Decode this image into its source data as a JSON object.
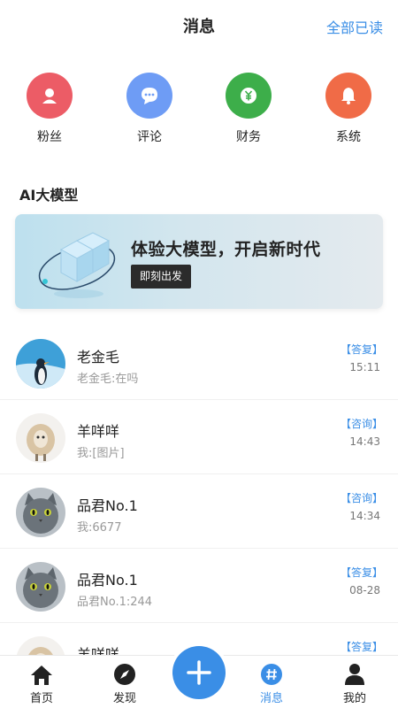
{
  "header": {
    "title": "消息",
    "mark_all_read": "全部已读"
  },
  "categories": [
    {
      "label": "粉丝",
      "icon": "person-icon",
      "color": "#ec5c66"
    },
    {
      "label": "评论",
      "icon": "chat-bubble-icon",
      "color": "#6e9cf5"
    },
    {
      "label": "财务",
      "icon": "yuan-icon",
      "color": "#3dae4a"
    },
    {
      "label": "系统",
      "icon": "bell-icon",
      "color": "#f06b47"
    }
  ],
  "ai_section": {
    "title": "AI大模型",
    "banner_headline": "体验大模型，开启新时代",
    "banner_button": "即刻出发"
  },
  "messages": [
    {
      "name": "老金毛",
      "preview": "老金毛:在吗",
      "tag": "【答复】",
      "time": "15:11",
      "avatar": "penguin"
    },
    {
      "name": "羊咩咩",
      "preview": "我:[图片]",
      "tag": "【咨询】",
      "time": "14:43",
      "avatar": "sheep"
    },
    {
      "name": "品君No.1",
      "preview": "我:6677",
      "tag": "【咨询】",
      "time": "14:34",
      "avatar": "cat"
    },
    {
      "name": "品君No.1",
      "preview": "品君No.1:244",
      "tag": "【答复】",
      "time": "08-28",
      "avatar": "cat"
    },
    {
      "name": "羊咩咩",
      "preview": "",
      "tag": "【答复】",
      "time": "",
      "avatar": "sheep"
    }
  ],
  "tabbar": {
    "home": "首页",
    "discover": "发现",
    "messages": "消息",
    "mine": "我的"
  },
  "colors": {
    "accent": "#3a8ee6"
  }
}
